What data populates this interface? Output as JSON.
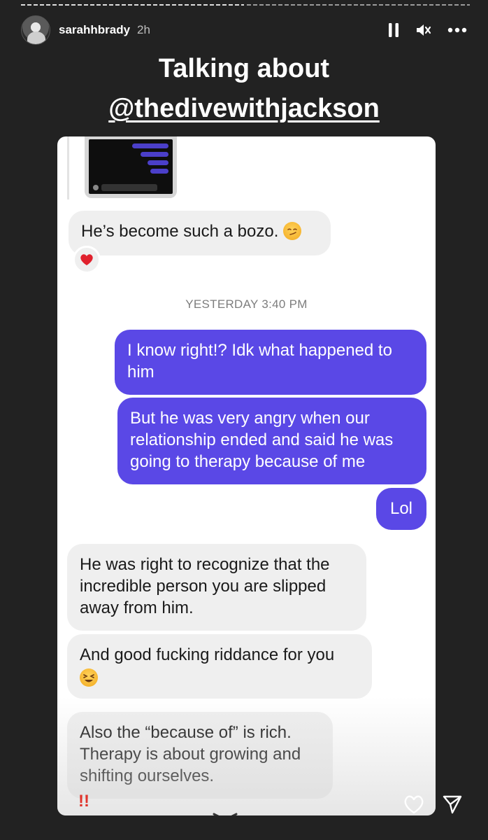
{
  "header": {
    "username": "sarahhbrady",
    "time": "2h"
  },
  "title": {
    "line1": "Talking about",
    "line2": "@thedivewithjackson"
  },
  "chat": {
    "messages": [
      {
        "id": "m1",
        "side": "in",
        "text": "He’s become such a bozo."
      },
      {
        "id": "m2",
        "side": "out",
        "text": "I know right!? Idk what happened to him"
      },
      {
        "id": "m3",
        "side": "out",
        "text": "But he was very angry when our relationship ended and said he was going to therapy because of me"
      },
      {
        "id": "m4",
        "side": "out",
        "text": "Lol"
      },
      {
        "id": "m5",
        "side": "in",
        "text": "He was right to recognize that the incredible person you are slipped away from him."
      },
      {
        "id": "m6",
        "side": "in",
        "text": "And good fucking riddance for you"
      },
      {
        "id": "m7",
        "side": "in",
        "text": "Also the “because of” is rich. Therapy is about growing and shifting ourselves."
      }
    ],
    "timestamp": "YESTERDAY 3:40 PM",
    "reaction_heart": "❤️",
    "exclaim": "!!"
  },
  "icons": {
    "pause": "pause-icon",
    "mute": "mute-icon",
    "more": "more-icon",
    "like": "heart-icon",
    "share": "send-icon"
  },
  "colors": {
    "outgoing_bubble": "#5a48e6",
    "incoming_bubble": "#efefef",
    "background": "#222222"
  }
}
